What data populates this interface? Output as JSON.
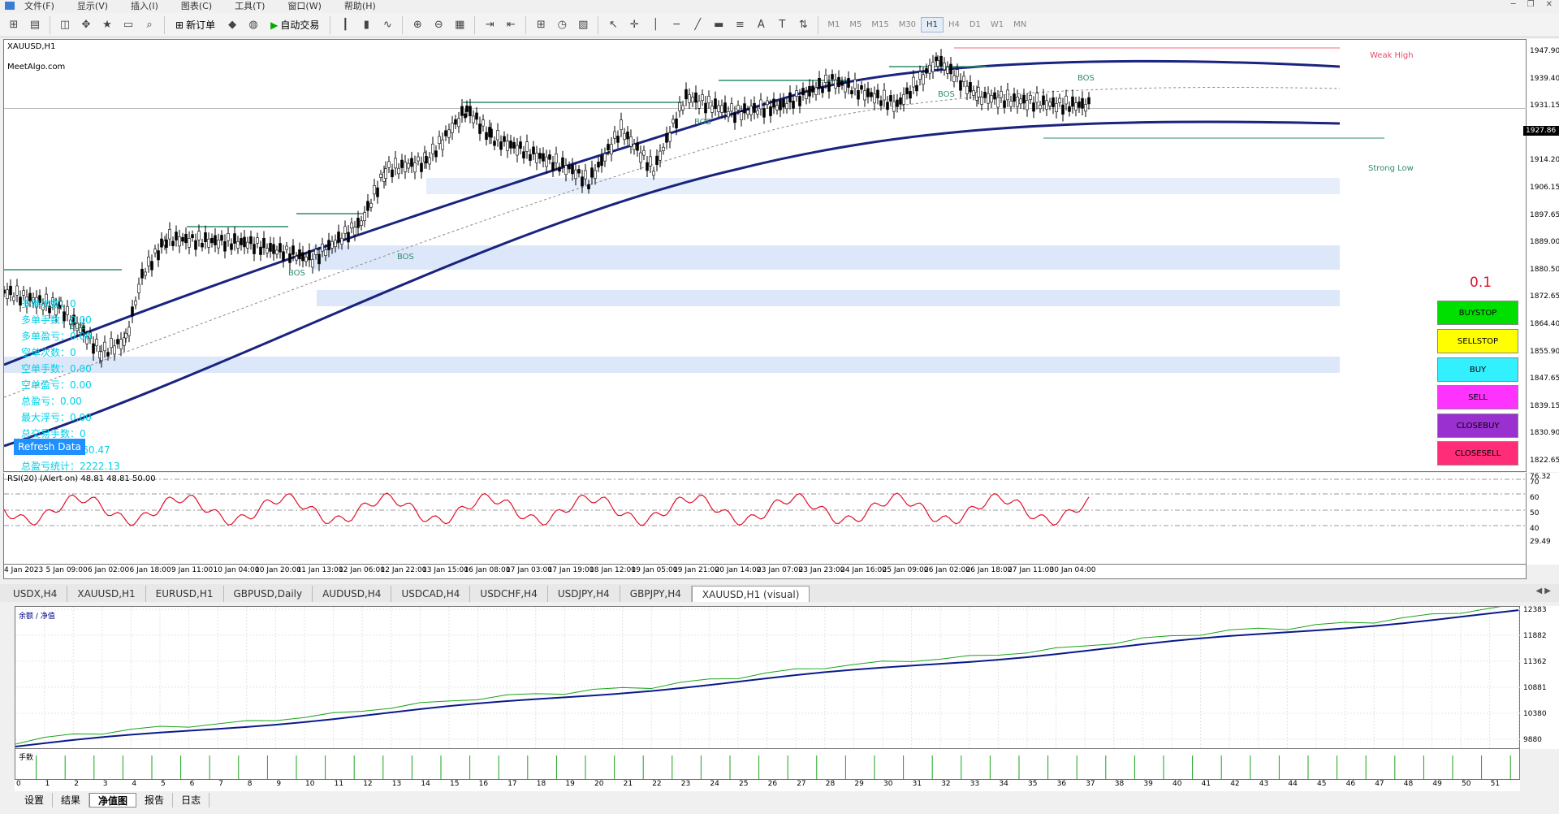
{
  "menu": [
    "文件(F)",
    "显示(V)",
    "插入(I)",
    "图表(C)",
    "工具(T)",
    "窗口(W)",
    "帮助(H)"
  ],
  "toolbar": {
    "new_order": "新订单",
    "auto_trading": "自动交易",
    "timeframes": [
      "M1",
      "M5",
      "M15",
      "M30",
      "H1",
      "H4",
      "D1",
      "W1",
      "MN"
    ],
    "active_tf": "H1"
  },
  "chart": {
    "symbol_title": "XAUUSD,H1",
    "site": "MeetAlgo.com",
    "labels": {
      "weak_high": "Weak High",
      "strong_low": "Strong Low",
      "bos": "BOS"
    },
    "current_price": "1927.86",
    "price_ticks": [
      "1947.90",
      "1939.40",
      "1931.15",
      "1922.65",
      "1914.20",
      "1906.15",
      "1897.65",
      "1889.00",
      "1880.50",
      "1872.65",
      "1864.40",
      "1855.90",
      "1847.65",
      "1839.15",
      "1830.90",
      "1822.65"
    ],
    "stats": [
      "多单次数：0",
      "多单手数：0.00",
      "多单盈亏：0.00",
      "空单次数：0",
      "空单手数：0.00",
      "空单盈亏：0.00",
      "总盈亏：0.00",
      "最大浮亏：0.00",
      "总交易手数：0",
      "今日盈亏：1160.47",
      "总盈亏统计：2222.13"
    ],
    "refresh_label": "Refresh Data",
    "lots": "0.1",
    "buttons": [
      {
        "label": "BUYSTOP",
        "color": "#00e000"
      },
      {
        "label": "SELLSTOP",
        "color": "#ffff00"
      },
      {
        "label": "BUY",
        "color": "#33f0ff"
      },
      {
        "label": "SELL",
        "color": "#ff33ff"
      },
      {
        "label": "CLOSEBUY",
        "color": "#9b30d0"
      },
      {
        "label": "CLOSESELL",
        "color": "#ff2d78"
      }
    ]
  },
  "rsi": {
    "label": "RSI(20) (Alert on) 48.81 48.81 50.00",
    "ticks": [
      "76.32",
      "70",
      "60",
      "50",
      "40",
      "29.49"
    ]
  },
  "time_axis": [
    "4 Jan 2023",
    "5 Jan 09:00",
    "6 Jan 02:00",
    "6 Jan 18:00",
    "9 Jan 11:00",
    "10 Jan 04:00",
    "10 Jan 20:00",
    "11 Jan 13:00",
    "12 Jan 06:00",
    "12 Jan 22:00",
    "13 Jan 15:00",
    "16 Jan 08:00",
    "17 Jan 03:00",
    "17 Jan 19:00",
    "18 Jan 12:00",
    "19 Jan 05:00",
    "19 Jan 21:00",
    "20 Jan 14:00",
    "23 Jan 07:00",
    "23 Jan 23:00",
    "24 Jan 16:00",
    "25 Jan 09:00",
    "26 Jan 02:00",
    "26 Jan 18:00",
    "27 Jan 11:00",
    "30 Jan 04:00"
  ],
  "tabs": [
    "USDX,H4",
    "XAUUSD,H1",
    "EURUSD,H1",
    "GBPUSD,Daily",
    "AUDUSD,H4",
    "USDCAD,H4",
    "USDCHF,H4",
    "USDJPY,H4",
    "GBPJPY,H4",
    "XAUUSD,H1 (visual)"
  ],
  "active_tab": "XAUUSD,H1 (visual)",
  "equity": {
    "label": "余额 / 净值",
    "ticks": [
      "12383",
      "11882",
      "11362",
      "10881",
      "10380",
      "9880"
    ],
    "vol_label": "手数",
    "x_ticks": [
      "0",
      "1",
      "2",
      "3",
      "4",
      "5",
      "6",
      "7",
      "8",
      "9",
      "10",
      "11",
      "12",
      "13",
      "14",
      "15",
      "16",
      "17",
      "18",
      "19",
      "20",
      "21",
      "22",
      "23",
      "24",
      "25",
      "26",
      "27",
      "28",
      "29",
      "30",
      "31",
      "32",
      "33",
      "34",
      "35",
      "36",
      "37",
      "38",
      "39",
      "40",
      "41",
      "42",
      "43",
      "44",
      "45",
      "46",
      "47",
      "48",
      "49",
      "50",
      "51"
    ]
  },
  "bottom_tabs": [
    "设置",
    "结果",
    "净值图",
    "报告",
    "日志"
  ],
  "active_bottom_tab": "净值图"
}
